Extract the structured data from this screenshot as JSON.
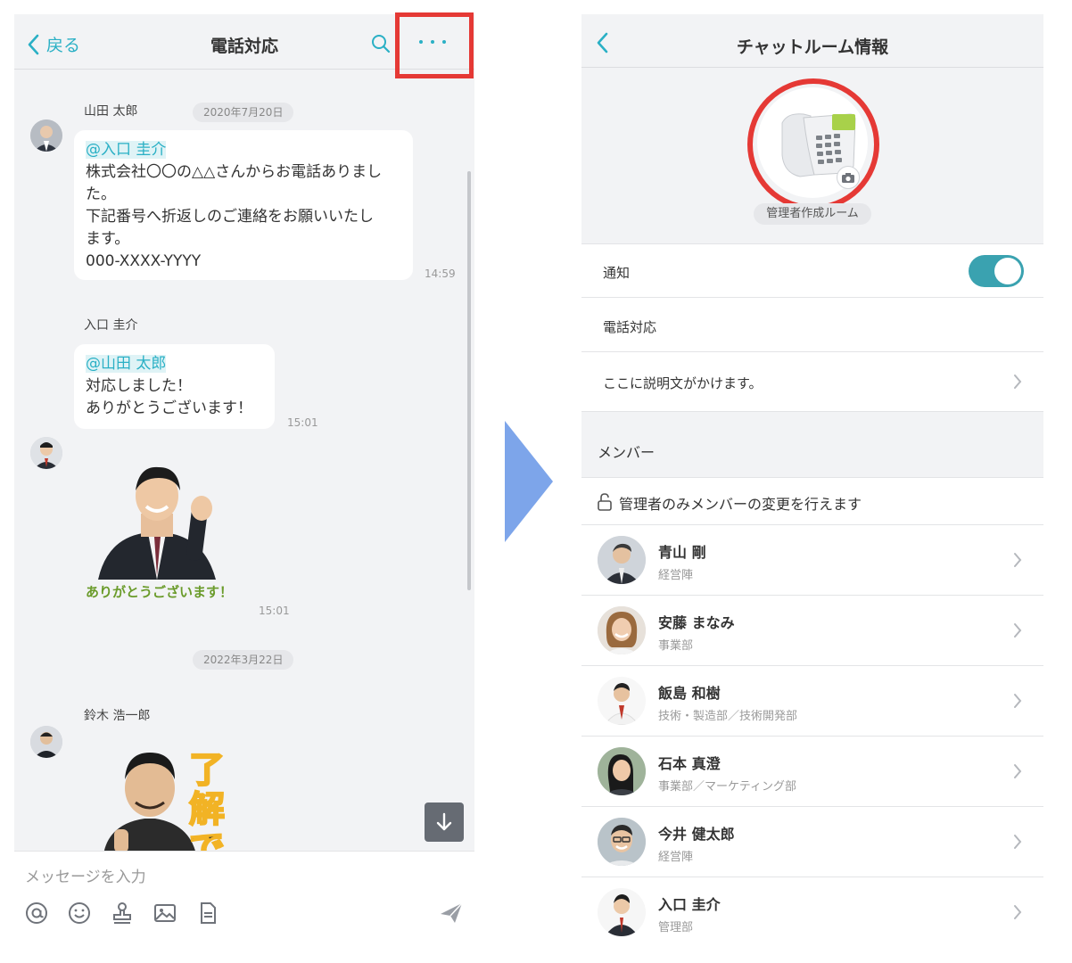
{
  "chat": {
    "back_label": "戻る",
    "title": "電話対応",
    "messages": [
      {
        "sender": "山田 太郎",
        "date": "2020年7月20日",
        "mention": "@入口 圭介",
        "lines": [
          "株式会社〇〇の△△さんからお電話ありまし",
          "た。",
          "下記番号へ折返しのご連絡をお願いいたし",
          "ます。",
          "000-XXXX-YYYY"
        ],
        "time": "14:59"
      },
      {
        "sender": "入口 圭介",
        "mention": "@山田 太郎",
        "lines": [
          "対応しました！",
          "ありがとうございます！"
        ],
        "time": "15:01"
      },
      {
        "sticker_text": "ありがとうございます！",
        "time": "15:01"
      },
      {
        "date": "2022年3月22日",
        "sender": "鈴木 浩一郎",
        "sticker_text": "了解で"
      }
    ],
    "composer_placeholder": "メッセージを入力"
  },
  "room_info": {
    "title": "チャットルーム情報",
    "badge": "管理者作成ルーム",
    "notification_label": "通知",
    "notification_on": true,
    "room_name": "電話対応",
    "description": "ここに説明文がかけます。",
    "members_header": "メンバー",
    "admin_notice": "管理者のみメンバーの変更を行えます",
    "members": [
      {
        "name": "青山 剛",
        "dept": "経営陣"
      },
      {
        "name": "安藤 まなみ",
        "dept": "事業部"
      },
      {
        "name": "飯島 和樹",
        "dept": "技術・製造部／技術開発部"
      },
      {
        "name": "石本 真澄",
        "dept": "事業部／マーケティング部"
      },
      {
        "name": "今井 健太郎",
        "dept": "経営陣"
      },
      {
        "name": "入口 圭介",
        "dept": "管理部"
      }
    ]
  },
  "colors": {
    "accent": "#2ab0c5",
    "highlight_red": "#e53935",
    "toggle": "#3aa2b0",
    "arrow": "#7da5ea",
    "sticker_green": "#6a9b2a"
  },
  "icons": [
    "chevron-left-icon",
    "search-icon",
    "more-icon",
    "arrow-down-icon",
    "at-icon",
    "emoji-icon",
    "stamp-icon",
    "image-icon",
    "file-icon",
    "send-icon",
    "phone-icon",
    "camera-icon",
    "chevron-right-icon",
    "lock-icon"
  ]
}
